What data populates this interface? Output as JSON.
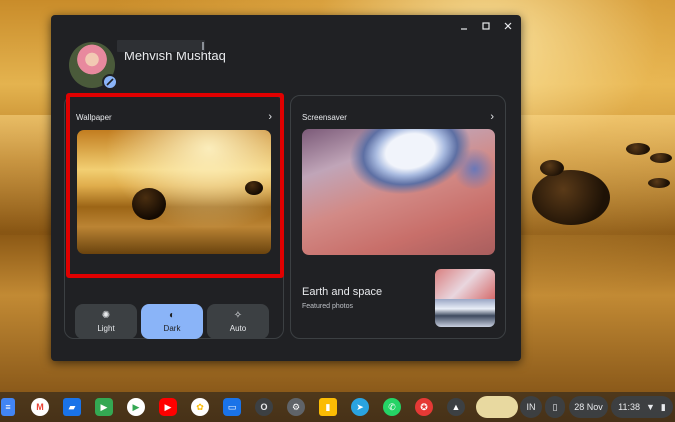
{
  "profile": {
    "name": "Mehvish Mushtaq"
  },
  "wallpaper_card": {
    "title": "Wallpaper",
    "chevron": "›"
  },
  "theme_modes": [
    {
      "label": "Light",
      "icon": "brightness-icon",
      "active": false
    },
    {
      "label": "Dark",
      "icon": "contrast-icon",
      "active": true
    },
    {
      "label": "Auto",
      "icon": "magic-wand-icon",
      "active": false
    }
  ],
  "screensaver_card": {
    "title": "Screensaver",
    "chevron": "›",
    "album_title": "Earth and space",
    "album_subtitle": "Featured photos"
  },
  "shelf": {
    "input_method": "IN",
    "date": "28 Nov",
    "time": "11:38"
  },
  "colors": {
    "accent": "#8ab4f8",
    "window_bg": "#202124",
    "highlight": "#e00000"
  }
}
